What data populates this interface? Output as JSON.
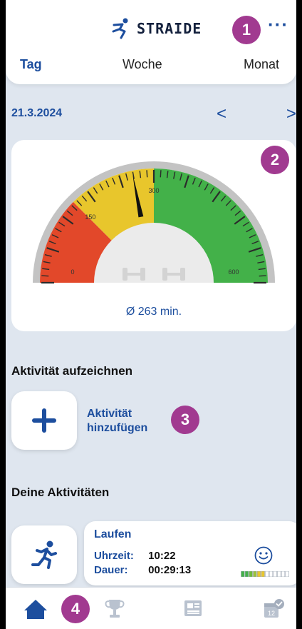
{
  "header": {
    "logo_text": "STRAIDE",
    "more_label": "···",
    "tabs": [
      {
        "label": "Tag",
        "active": true
      },
      {
        "label": "Woche",
        "active": false
      },
      {
        "label": "Monat",
        "active": false
      }
    ]
  },
  "date_nav": {
    "date": "21.3.2024",
    "prev_label": "<",
    "next_label": ">"
  },
  "gauge": {
    "min": 0,
    "max": 600,
    "value": 263,
    "zones": [
      {
        "from": 0,
        "to": 150,
        "color": "#e2482a"
      },
      {
        "from": 150,
        "to": 300,
        "color": "#e8c62c"
      },
      {
        "from": 300,
        "to": 600,
        "color": "#43b149"
      }
    ],
    "tick_labels": [
      "0",
      "150",
      "300",
      "600"
    ],
    "average_label": "Ø 263 min."
  },
  "record_section": {
    "title": "Aktivität aufzeichnen",
    "add_label": "Aktivität\nhinzufügen"
  },
  "activities_section": {
    "title": "Deine Aktivitäten",
    "items": [
      {
        "name": "Laufen",
        "time_label": "Uhrzeit:",
        "time_value": "10:22",
        "duration_label": "Dauer:",
        "duration_value": "00:29:13",
        "mood_icon": "smiley-icon",
        "intensity_level": 0.5
      }
    ]
  },
  "badges": [
    "1",
    "2",
    "3",
    "4"
  ],
  "bottom_nav": {
    "items": [
      {
        "icon": "home-icon",
        "active": true
      },
      {
        "icon": "trophy-icon",
        "active": false
      },
      {
        "icon": "news-icon",
        "active": false
      },
      {
        "icon": "calendar-icon",
        "active": false
      }
    ]
  },
  "colors": {
    "accent": "#1d4e9e",
    "badge": "#a13a90",
    "background": "#dfe6ef"
  }
}
